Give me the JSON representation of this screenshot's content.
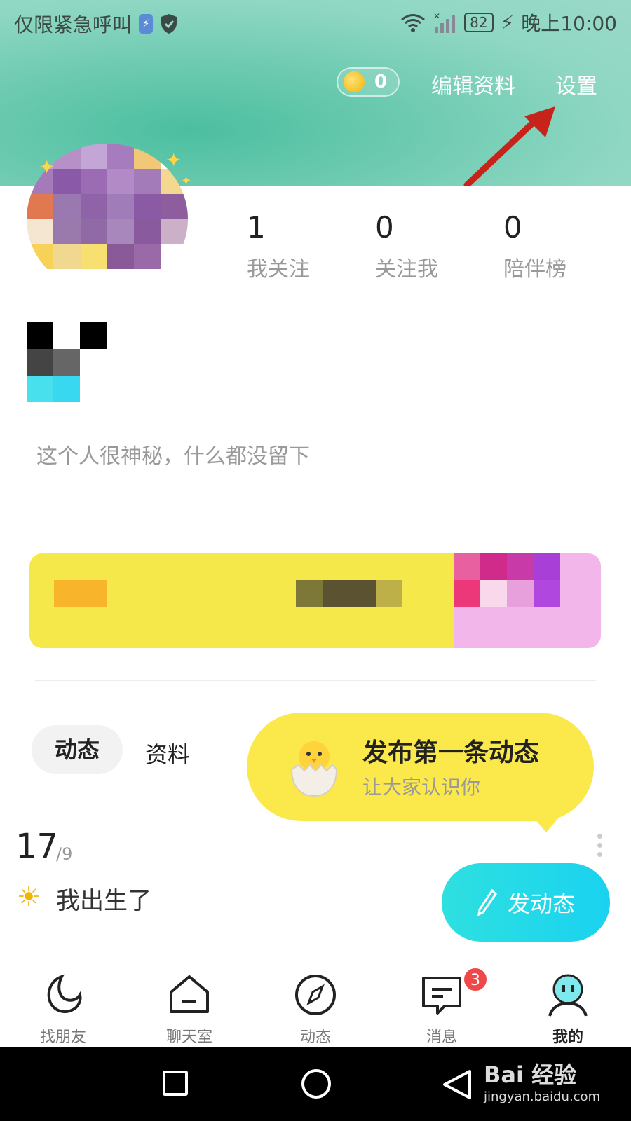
{
  "status_bar": {
    "carrier_text": "仅限紧急呼叫",
    "battery": "82",
    "time": "晚上10:00",
    "icons": [
      "charging-icon",
      "shield-icon",
      "wifi-icon",
      "signal-icon",
      "battery-icon"
    ]
  },
  "header": {
    "coin_count": "0",
    "edit_profile_label": "编辑资料",
    "settings_label": "设置",
    "annotation_color": "#c8231a"
  },
  "profile": {
    "stats": [
      {
        "num": "1",
        "label": "我关注"
      },
      {
        "num": "0",
        "label": "关注我"
      },
      {
        "num": "0",
        "label": "陪伴榜"
      }
    ],
    "bio": "这个人很神秘，什么都没留下"
  },
  "tabs": {
    "active": "动态",
    "inactive": "资料"
  },
  "post_prompt": {
    "title": "发布第一条动态",
    "subtitle": "让大家认识你"
  },
  "timeline": {
    "day": "17",
    "month": "/9",
    "entry": "我出生了"
  },
  "post_button": {
    "label": "发动态"
  },
  "bottom_nav": {
    "items": [
      {
        "label": "找朋友",
        "icon": "moon-icon"
      },
      {
        "label": "聊天室",
        "icon": "house-icon"
      },
      {
        "label": "动态",
        "icon": "compass-icon"
      },
      {
        "label": "消息",
        "icon": "message-icon"
      },
      {
        "label": "我的",
        "icon": "profile-icon"
      }
    ],
    "message_badge": "3",
    "accent": "#2ee0e0"
  },
  "watermark": {
    "main": "Bai 经验",
    "sub": "jingyan.baidu.com"
  }
}
